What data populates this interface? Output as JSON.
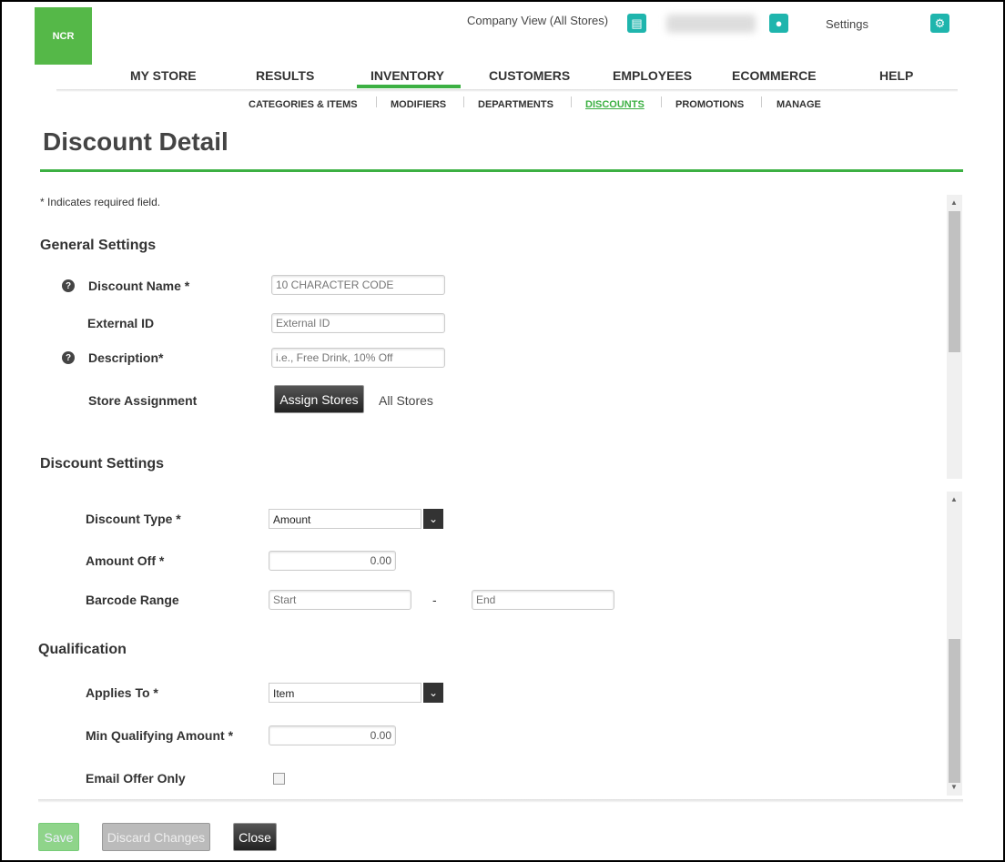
{
  "header": {
    "logo": "NCR",
    "company_view": "Company View (All Stores)",
    "settings": "Settings",
    "store_icon": "store-icon",
    "user_icon": "user-icon",
    "gear_icon": "gear-icon"
  },
  "nav": [
    {
      "label": "MY STORE"
    },
    {
      "label": "RESULTS"
    },
    {
      "label": "INVENTORY",
      "active": true
    },
    {
      "label": "CUSTOMERS"
    },
    {
      "label": "EMPLOYEES"
    },
    {
      "label": "ECOMMERCE"
    },
    {
      "label": "HELP"
    }
  ],
  "subnav": [
    {
      "label": "CATEGORIES & ITEMS"
    },
    {
      "label": "MODIFIERS"
    },
    {
      "label": "DEPARTMENTS"
    },
    {
      "label": "DISCOUNTS",
      "active": true
    },
    {
      "label": "PROMOTIONS"
    },
    {
      "label": "MANAGE"
    }
  ],
  "page": {
    "title": "Discount Detail",
    "required_note": "* Indicates required field."
  },
  "general": {
    "title": "General Settings",
    "discount_name": {
      "label": "Discount Name *",
      "placeholder": "10 CHARACTER CODE"
    },
    "external_id": {
      "label": "External ID",
      "placeholder": "External ID"
    },
    "description": {
      "label": "Description*",
      "placeholder": "i.e., Free Drink, 10% Off"
    },
    "store_assignment": {
      "label": "Store Assignment",
      "button": "Assign Stores",
      "value": "All Stores"
    }
  },
  "discount": {
    "title": "Discount Settings",
    "type": {
      "label": "Discount Type *",
      "value": "Amount"
    },
    "amount_off": {
      "label": "Amount Off *",
      "value": "0.00"
    },
    "barcode": {
      "label": "Barcode Range",
      "start": "Start",
      "dash": "-",
      "end": "End"
    }
  },
  "qualification": {
    "title": "Qualification",
    "applies_to": {
      "label": "Applies To *",
      "value": "Item"
    },
    "min_amount": {
      "label": "Min Qualifying Amount *",
      "value": "0.00"
    },
    "email_only": {
      "label": "Email Offer Only",
      "checked": false
    }
  },
  "footer": {
    "save": "Save",
    "discard": "Discard Changes",
    "close": "Close"
  },
  "colors": {
    "accent": "#3cb043",
    "teal": "#1fb5ad"
  }
}
